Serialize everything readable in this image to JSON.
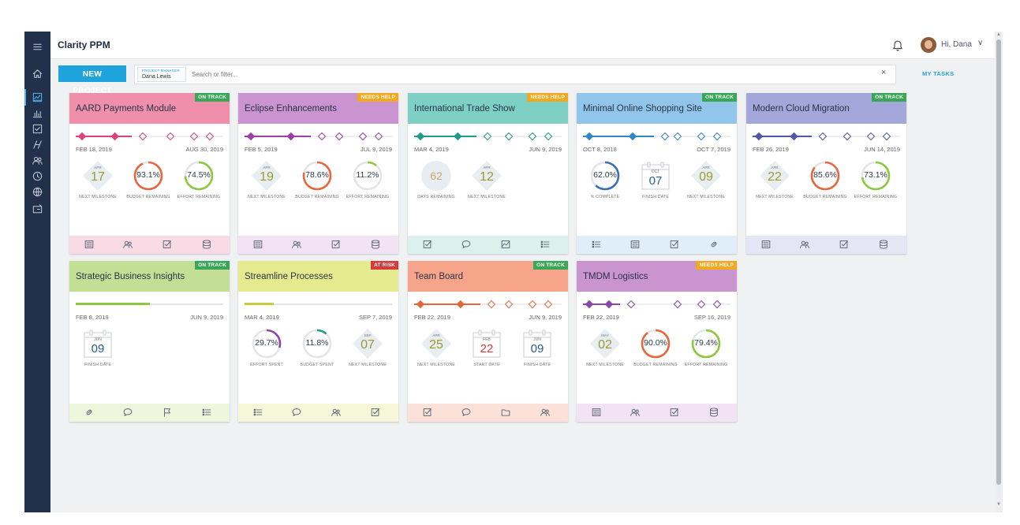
{
  "header": {
    "app_title": "Clarity PPM",
    "greeting": "Hi, Dana",
    "bell_icon": "bell-icon",
    "chevron": "∨"
  },
  "toolbar": {
    "new_project_label": "NEW PROJECT",
    "project_manager_label": "PROJECT MANAGER",
    "project_manager_value": "Dana Lewis",
    "search_placeholder": "Search or filter...",
    "clear_icon": "×",
    "my_tasks_label": "MY TASKS"
  },
  "sidebar": {
    "items": [
      {
        "name": "menu-icon"
      },
      {
        "name": "home-icon"
      },
      {
        "name": "dashboard-icon",
        "active": true
      },
      {
        "name": "reports-icon"
      },
      {
        "name": "tasks-icon"
      },
      {
        "name": "roadmap-icon"
      },
      {
        "name": "resources-icon"
      },
      {
        "name": "timesheet-icon"
      },
      {
        "name": "global-icon"
      },
      {
        "name": "financials-icon"
      }
    ]
  },
  "colors": {
    "on_track": "#3aa657",
    "needs_help": "#f2a91d",
    "at_risk": "#d63a3a",
    "accent": "#1fa3dc"
  },
  "cards": [
    {
      "title": "AARD Payments Module",
      "status": "ON TRACK",
      "status_color": "#3aa657",
      "head_color": "#ef8fac",
      "foot_color": "#f9dbe5",
      "track_color": "#e0407a",
      "track": "diamond",
      "progress": 0.38,
      "start_date": "FEB 18, 2019",
      "end_date": "AUG 30, 2019",
      "metrics": [
        {
          "kind": "diamond",
          "month": "APR",
          "day": "17",
          "label": "NEXT MILESTONE"
        },
        {
          "kind": "ring",
          "value": "93.1%",
          "pct": 93.1,
          "color": "#e8663c",
          "label": "BUDGET REMAINING"
        },
        {
          "kind": "ring",
          "value": "74.5%",
          "pct": 74.5,
          "color": "#8dc63f",
          "label": "EFFORT REMAINING"
        }
      ],
      "footer_icons": [
        "report-icon",
        "team-icon",
        "checklist-icon",
        "database-icon"
      ]
    },
    {
      "title": "Eclipse Enhancements",
      "status": "NEEDS HELP",
      "status_color": "#f2a91d",
      "head_color": "#c994cf",
      "foot_color": "#f1e3f3",
      "track_color": "#9c3fa8",
      "track": "diamond",
      "progress": 0.45,
      "start_date": "FEB 5, 2019",
      "end_date": "JUL 9, 2019",
      "metrics": [
        {
          "kind": "diamond",
          "month": "APR",
          "day": "19",
          "label": "NEXT MILESTONE"
        },
        {
          "kind": "ring",
          "value": "78.6%",
          "pct": 78.6,
          "color": "#e8663c",
          "label": "BUDGET REMAINING"
        },
        {
          "kind": "ring",
          "value": "11.2%",
          "pct": 11.2,
          "color": "#8dc63f",
          "label": "EFFORT REMAINING"
        }
      ],
      "footer_icons": [
        "report-icon",
        "team-icon",
        "checklist-icon",
        "database-icon"
      ]
    },
    {
      "title": "International Trade Show",
      "status": "NEEDS HELP",
      "status_color": "#f2a91d",
      "head_color": "#7ecfc4",
      "foot_color": "#dcf1ee",
      "track_color": "#1c9c8a",
      "track": "diamond",
      "progress": 0.42,
      "start_date": "MAR 4, 2019",
      "end_date": "JUN 9, 2019",
      "metrics": [
        {
          "kind": "bigcircle",
          "value": "62",
          "label": "DAYS REMAINING"
        },
        {
          "kind": "diamond",
          "month": "APR",
          "day": "12",
          "label": "NEXT MILESTONE"
        }
      ],
      "footer_icons": [
        "checklist-icon",
        "comment-icon",
        "chart-icon",
        "list-icon"
      ]
    },
    {
      "title": "Minimal Online Shopping Site",
      "status": "ON TRACK",
      "status_color": "#3aa657",
      "head_color": "#91c6ea",
      "foot_color": "#dfeef9",
      "track_color": "#2f87c7",
      "track": "diamond",
      "progress": 0.48,
      "start_date": "OCT 8, 2018",
      "end_date": "OCT 7, 2019",
      "metrics": [
        {
          "kind": "ring",
          "value": "62.0%",
          "pct": 62.0,
          "color": "#3b6fb5",
          "label": "% COMPLETE"
        },
        {
          "kind": "calendar",
          "month": "OCT",
          "day": "07",
          "label": "FINISH DATE"
        },
        {
          "kind": "diamond",
          "month": "APR",
          "day": "09",
          "label": "NEXT MILESTONE"
        }
      ],
      "footer_icons": [
        "list-icon",
        "report-icon",
        "checklist-icon",
        "link-icon"
      ]
    },
    {
      "title": "Modern Cloud Migration",
      "status": "ON TRACK",
      "status_color": "#3aa657",
      "head_color": "#a3a7da",
      "foot_color": "#e5e6f5",
      "track_color": "#4e58a8",
      "track": "diamond",
      "progress": 0.4,
      "start_date": "FEB 26, 2019",
      "end_date": "JUN 14, 2019",
      "metrics": [
        {
          "kind": "diamond",
          "month": "APR",
          "day": "22",
          "label": "NEXT MILESTONE"
        },
        {
          "kind": "ring",
          "value": "85.6%",
          "pct": 85.6,
          "color": "#e8663c",
          "label": "BUDGET REMAINING"
        },
        {
          "kind": "ring",
          "value": "73.1%",
          "pct": 73.1,
          "color": "#8dc63f",
          "label": "EFFORT REMAINING"
        }
      ],
      "footer_icons": [
        "report-icon",
        "team-icon",
        "checklist-icon",
        "database-icon"
      ]
    },
    {
      "title": "Strategic Business Insights",
      "status": "ON TRACK",
      "status_color": "#3aa657",
      "head_color": "#c3de95",
      "foot_color": "#edf5dd",
      "track_color": "#8dc63f",
      "track": "line",
      "progress": 0.5,
      "start_date": "FEB 8, 2019",
      "end_date": "JUN 9, 2019",
      "metrics": [
        {
          "kind": "calendar",
          "month": "JUN",
          "day": "09",
          "label": "FINISH DATE"
        }
      ],
      "footer_icons": [
        "link-icon",
        "comment-icon",
        "flag-icon",
        "list-icon"
      ]
    },
    {
      "title": "Streamline Processes",
      "status": "AT RISK",
      "status_color": "#d63a3a",
      "head_color": "#e6ea8e",
      "foot_color": "#f6f7d9",
      "track_color": "#c8cc3a",
      "track": "line",
      "progress": 0.2,
      "start_date": "MAR 4, 2019",
      "end_date": "SEP 7, 2019",
      "metrics": [
        {
          "kind": "ring",
          "value": "29.7%",
          "pct": 29.7,
          "color": "#8e44ad",
          "label": "EFFORT SPENT"
        },
        {
          "kind": "ring",
          "value": "11.8%",
          "pct": 11.8,
          "color": "#1c9c8a",
          "label": "BUDGET SPENT"
        },
        {
          "kind": "diamond",
          "month": "SEP",
          "day": "07",
          "label": "NEXT MILESTONE"
        }
      ],
      "footer_icons": [
        "list-icon",
        "comment-icon",
        "team-icon",
        "checklist-icon"
      ]
    },
    {
      "title": "Team Board",
      "status": "ON TRACK",
      "status_color": "#3aa657",
      "head_color": "#f6a58a",
      "foot_color": "#fbe1d8",
      "track_color": "#e8663c",
      "track": "diamond",
      "progress": 0.45,
      "start_date": "FEB 22, 2019",
      "end_date": "JUN 9, 2019",
      "metrics": [
        {
          "kind": "diamond",
          "month": "APR",
          "day": "25",
          "label": "NEXT MILESTONE"
        },
        {
          "kind": "calendar",
          "month": "FEB",
          "day": "22",
          "label": "START DATE",
          "day_color": "#d63a3a"
        },
        {
          "kind": "calendar",
          "month": "JUN",
          "day": "09",
          "label": "FINISH DATE"
        }
      ],
      "footer_icons": [
        "checklist-icon",
        "comment-icon",
        "folder-icon",
        "team-icon"
      ]
    },
    {
      "title": "TMDM Logistics",
      "status": "NEEDS HELP",
      "status_color": "#f2a91d",
      "head_color": "#c994cf",
      "foot_color": "#f1e3f3",
      "track_color": "#8e44ad",
      "track": "diamond",
      "progress": 0.25,
      "start_date": "FEB 22, 2019",
      "end_date": "SEP 16, 2019",
      "metrics": [
        {
          "kind": "diamond",
          "month": "MAY",
          "day": "02",
          "label": "NEXT MILESTONE"
        },
        {
          "kind": "ring",
          "value": "90.0%",
          "pct": 90.0,
          "color": "#e8663c",
          "label": "BUDGET REMAINING"
        },
        {
          "kind": "ring",
          "value": "79.4%",
          "pct": 79.4,
          "color": "#8dc63f",
          "label": "EFFORT REMAINING"
        }
      ],
      "footer_icons": [
        "report-icon",
        "team-icon",
        "checklist-icon",
        "database-icon"
      ]
    }
  ]
}
